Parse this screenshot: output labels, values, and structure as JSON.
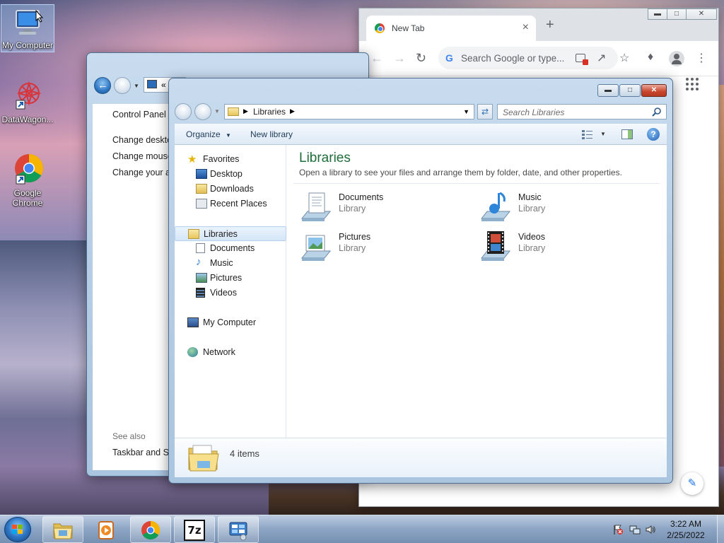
{
  "desktop": {
    "icons": [
      {
        "label": "My Computer"
      },
      {
        "label": "DataWagon..."
      },
      {
        "label": "Google Chrome"
      }
    ]
  },
  "chrome": {
    "tab_title": "New Tab",
    "omnibox_placeholder": "Search Google or type..."
  },
  "control_panel": {
    "breadcrumb": "«",
    "heading": "Control Panel H",
    "links": [
      "Change deskto",
      "Change mouse",
      "Change your a"
    ],
    "see_also": "See also",
    "see_also_link": "Taskbar and St"
  },
  "explorer": {
    "address": "Libraries",
    "search_placeholder": "Search Libraries",
    "commands": {
      "organize": "Organize",
      "new_library": "New library"
    },
    "nav": {
      "favorites": "Favorites",
      "favorites_items": [
        "Desktop",
        "Downloads",
        "Recent Places"
      ],
      "libraries": "Libraries",
      "libraries_items": [
        "Documents",
        "Music",
        "Pictures",
        "Videos"
      ],
      "computer": "My Computer",
      "network": "Network"
    },
    "heading": "Libraries",
    "subheading": "Open a library to see your files and arrange them by folder, date, and other properties.",
    "libraries": [
      {
        "name": "Documents",
        "type": "Library"
      },
      {
        "name": "Music",
        "type": "Library"
      },
      {
        "name": "Pictures",
        "type": "Library"
      },
      {
        "name": "Videos",
        "type": "Library"
      }
    ],
    "item_count": "4 items"
  },
  "taskbar": {
    "time": "3:22 AM",
    "date": "2/25/2022"
  }
}
